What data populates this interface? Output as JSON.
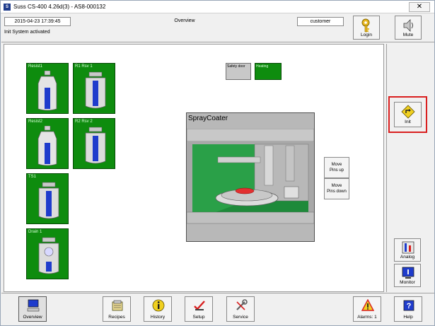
{
  "window": {
    "title": "Suss  CS-400  4.26d(3) - AS8-000132",
    "close_symbol": "✕"
  },
  "header": {
    "datetime": "2015-04-23  17:39:45",
    "screen_name": "Overview",
    "user": "customer",
    "status_message": "Init System activated",
    "login_label": "Login",
    "mute_label": "Mute"
  },
  "tiles": [
    {
      "label": "Resist1",
      "fill_level": 0.55,
      "color": "#0e8c0e"
    },
    {
      "label": "R1 Rsv 1",
      "fill_level": 0.9,
      "color": "#0e8c0e"
    },
    {
      "label": "Resist2",
      "fill_level": 0.55,
      "color": "#0e8c0e"
    },
    {
      "label": "R2 Rsv 2",
      "fill_level": 0.9,
      "color": "#0e8c0e"
    },
    {
      "label": "TS1",
      "fill_level": 0.9,
      "color": "#0e8c0e"
    },
    {
      "label": "Drain 1",
      "fill_level": 0.3,
      "color": "#0e8c0e"
    }
  ],
  "indicators": {
    "safety_door": "Safety door",
    "heating": "Heating"
  },
  "coater": {
    "title": "SprayCoater"
  },
  "pins": {
    "up_label_1": "Move",
    "up_label_2": "Pins up",
    "down_label_1": "Move",
    "down_label_2": "Pins down"
  },
  "side": {
    "init_label": "Init",
    "analog_label": "Analog",
    "monitor_label": "Monitor"
  },
  "bottom": {
    "overview_label": "Overview",
    "recipes_label": "Recipes",
    "history_label": "History",
    "setup_label": "Setup",
    "service_label": "Service",
    "alarms_label": "Alarms: 1",
    "help_label": "Help"
  },
  "colors": {
    "ok_green": "#0e8c0e",
    "highlight_red": "#d91f1f",
    "fill_blue": "#1f3ccc"
  }
}
